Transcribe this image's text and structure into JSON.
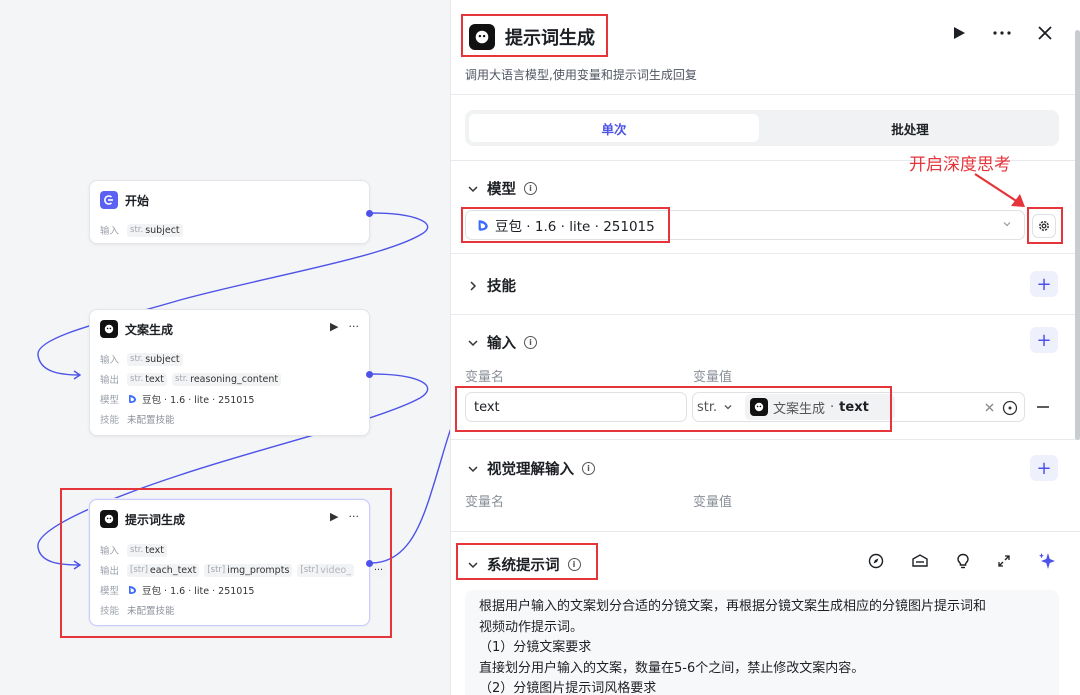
{
  "canvas": {
    "start_node": {
      "title": "开始",
      "input_label": "输入",
      "input_var": {
        "type": "str.",
        "name": "subject"
      }
    },
    "copy_node": {
      "title": "文案生成",
      "input_label": "输入",
      "input_var": {
        "type": "str.",
        "name": "subject"
      },
      "output_label": "输出",
      "outputs": [
        {
          "type": "str.",
          "name": "text"
        },
        {
          "type": "str.",
          "name": "reasoning_content"
        }
      ],
      "model_label": "模型",
      "model_value": "豆包 · 1.6 · lite · 251015",
      "skill_label": "技能",
      "skill_value": "未配置技能",
      "run_glyph": "▶",
      "more_glyph": "···"
    },
    "prompt_node": {
      "title": "提示词生成",
      "input_label": "输入",
      "input_var": {
        "type": "str.",
        "name": "text"
      },
      "output_label": "输出",
      "outputs": [
        {
          "type": "[str]",
          "name": "each_text"
        },
        {
          "type": "[str]",
          "name": "img_prompts"
        },
        {
          "type": "[str]",
          "name": "video_"
        }
      ],
      "overflow": "···",
      "model_label": "模型",
      "model_value": "豆包 · 1.6 · lite · 251015",
      "skill_label": "技能",
      "skill_value": "未配置技能",
      "run_glyph": "▶",
      "more_glyph": "···"
    }
  },
  "panel": {
    "title": "提示词生成",
    "description": "调用大语言模型,使用变量和提示词生成回复",
    "tabs": [
      {
        "label": "单次",
        "active": true
      },
      {
        "label": "批处理",
        "active": false
      }
    ],
    "annotation": "开启深度思考",
    "model_section": {
      "title": "模型",
      "selected": "豆包 · 1.6 · lite · 251015"
    },
    "skills_section": {
      "title": "技能"
    },
    "input_section": {
      "title": "输入",
      "col_name": "变量名",
      "col_value": "变量值",
      "var_name": "text",
      "var_type": "str.",
      "ref_node": "文案生成",
      "ref_sep": "·",
      "ref_field": "text"
    },
    "vision_section": {
      "title": "视觉理解输入",
      "col_name": "变量名",
      "col_value": "变量值"
    },
    "system_prompt": {
      "title": "系统提示词",
      "lines": [
        "根据用户输入的文案划分合适的分镜文案，再根据分镜文案生成相应的分镜图片提示词和",
        "视频动作提示词。",
        "（1）分镜文案要求",
        "直接划分用户输入的文案，数量在5-6个之间，禁止修改文案内容。",
        "（2）分镜图片提示词风格要求"
      ]
    },
    "colors": {
      "accent": "#4d53e8",
      "annotation": "#e5343a"
    }
  }
}
